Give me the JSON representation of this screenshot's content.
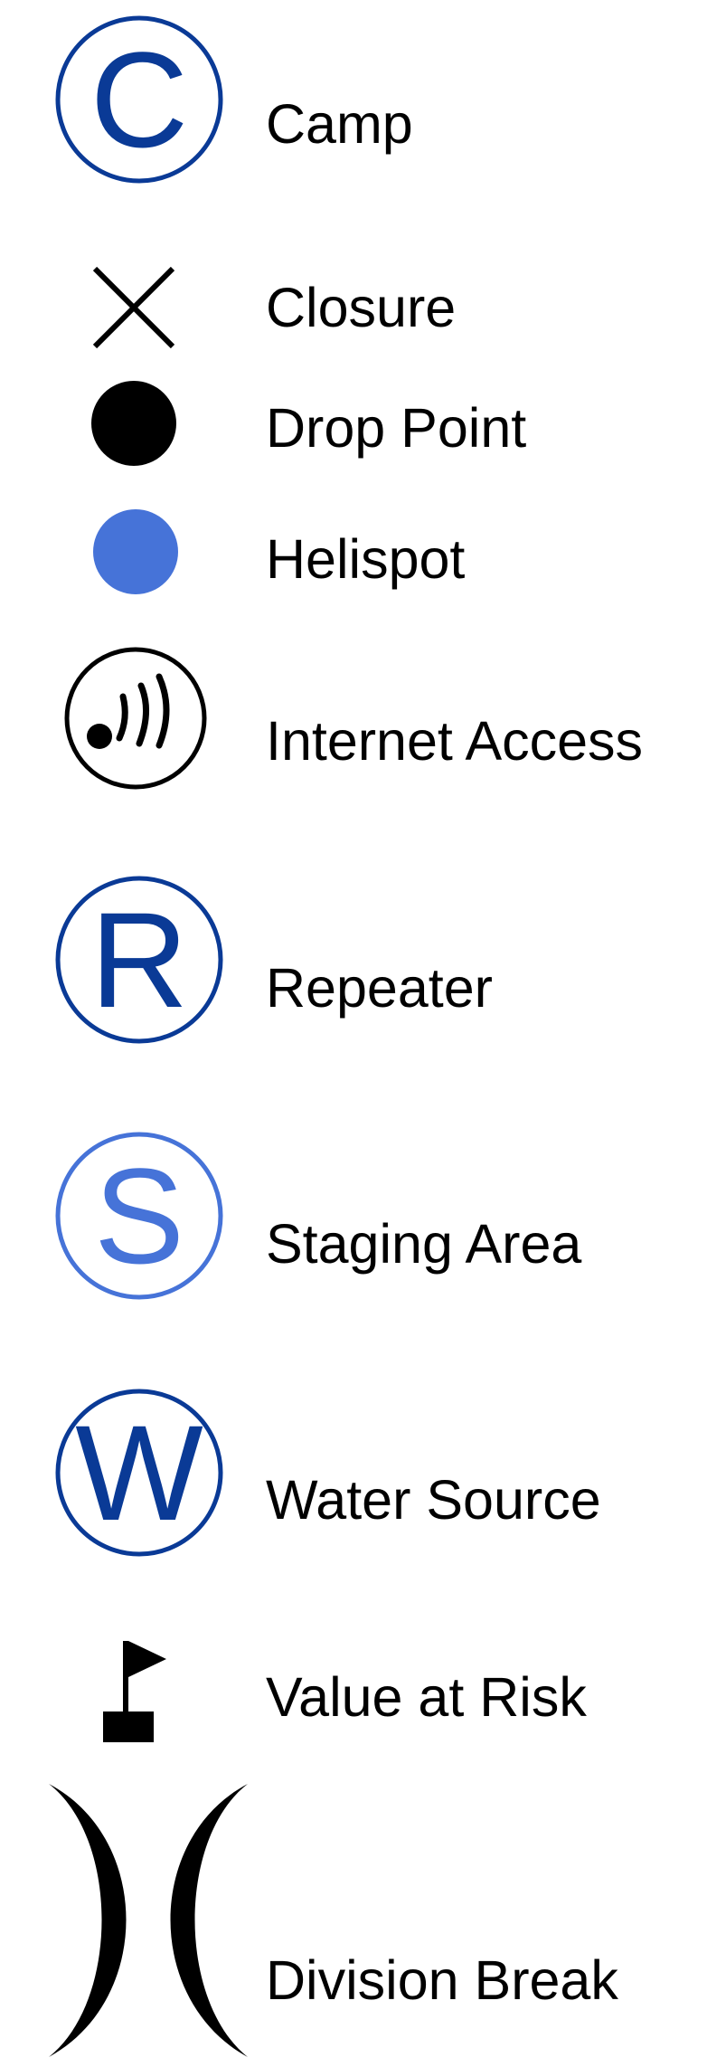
{
  "colors": {
    "dark_blue": "#0a3a96",
    "light_blue": "#4673d8",
    "black": "#000000"
  },
  "legend": {
    "items": [
      {
        "icon": "camp-icon",
        "letter": "C",
        "label": "Camp"
      },
      {
        "icon": "closure-icon",
        "label": "Closure"
      },
      {
        "icon": "drop-point-icon",
        "label": "Drop Point"
      },
      {
        "icon": "helispot-icon",
        "label": "Helispot"
      },
      {
        "icon": "internet-access-icon",
        "label": "Internet Access"
      },
      {
        "icon": "repeater-icon",
        "letter": "R",
        "label": "Repeater"
      },
      {
        "icon": "staging-area-icon",
        "letter": "S",
        "label": "Staging Area"
      },
      {
        "icon": "water-source-icon",
        "letter": "W",
        "label": "Water Source"
      },
      {
        "icon": "value-at-risk-icon",
        "label": "Value at Risk"
      },
      {
        "icon": "division-break-icon",
        "label": "Division Break"
      }
    ]
  }
}
